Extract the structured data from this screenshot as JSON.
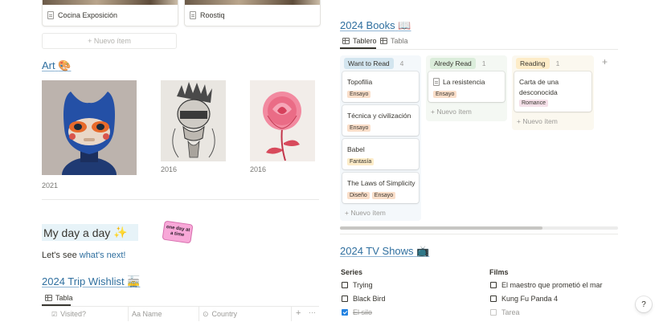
{
  "left": {
    "gallery_top": [
      {
        "title": "Cocina Exposición"
      },
      {
        "title": "Roostiq"
      }
    ],
    "new_item_label": "+ Nuevo ítem",
    "art": {
      "title": "Art",
      "emoji": "🎨",
      "items": [
        {
          "year": "2021",
          "image": "blue-cat-robot"
        },
        {
          "year": "2016",
          "image": "skull-sketch"
        },
        {
          "year": "2016",
          "image": "pink-rose"
        }
      ]
    },
    "my_day": {
      "title": "My day a day",
      "emoji": "✨",
      "sticker_text": "one day at a time",
      "lets_see_prefix": "Let's see ",
      "lets_see_link": "what's next!"
    },
    "trip": {
      "title": "2024 Trip Wishlist",
      "emoji": "🚋",
      "view_tab": "Tabla",
      "columns": [
        "Visited?",
        "Aa Name",
        "Country"
      ],
      "add": "+",
      "more": "···"
    }
  },
  "books": {
    "title": "2024 Books",
    "emoji": "📖",
    "tabs": [
      {
        "label": "Tablero",
        "active": true
      },
      {
        "label": "Tabla",
        "active": false
      }
    ],
    "columns": [
      {
        "name": "Want to Read",
        "count": "4",
        "color": "#d3e5ef",
        "bg": "#f4f8fb",
        "cards": [
          {
            "title": "Topofilia",
            "tags": [
              {
                "label": "Ensayo",
                "color": "#fadec9"
              }
            ]
          },
          {
            "title": "Técnica y civilización",
            "tags": [
              {
                "label": "Ensayo",
                "color": "#fadec9"
              }
            ]
          },
          {
            "title": "Babel",
            "tags": [
              {
                "label": "Fantasía",
                "color": "#fdecc8"
              }
            ]
          },
          {
            "title": "The Laws of Simplicity",
            "tags": [
              {
                "label": "Diseño",
                "color": "#fadec9"
              },
              {
                "label": "Ensayo",
                "color": "#fadec9"
              }
            ]
          }
        ],
        "new_label": "+ Nuevo ítem"
      },
      {
        "name": "Alredy Read",
        "count": "1",
        "color": "#dbeddb",
        "bg": "#f4f8f3",
        "cards": [
          {
            "title": "La resistencia",
            "tags": [
              {
                "label": "Ensayo",
                "color": "#fadec9"
              }
            ]
          }
        ],
        "new_label": "+ Nuevo ítem"
      },
      {
        "name": "Reading",
        "count": "1",
        "color": "#fdecc8",
        "bg": "#fbf8ef",
        "cards": [
          {
            "title": "Carta de una desconocida",
            "tags": [
              {
                "label": "Romance",
                "color": "#f5e0e9"
              }
            ]
          }
        ],
        "new_label": "+ Nuevo ítem"
      }
    ],
    "add_column": "+"
  },
  "tv": {
    "title": "2024 TV Shows",
    "emoji": "📺",
    "series": {
      "heading": "Series",
      "items": [
        {
          "label": "Trying",
          "checked": false
        },
        {
          "label": "Black Bird",
          "checked": false
        },
        {
          "label": "El silo",
          "checked": true
        }
      ]
    },
    "films": {
      "heading": "Films",
      "items": [
        {
          "label": "El maestro que prometió el mar",
          "checked": false
        },
        {
          "label": "Kung Fu Panda 4",
          "checked": false
        },
        {
          "label": "Tarea",
          "checked": false,
          "placeholder": true
        }
      ]
    }
  },
  "help_label": "?"
}
